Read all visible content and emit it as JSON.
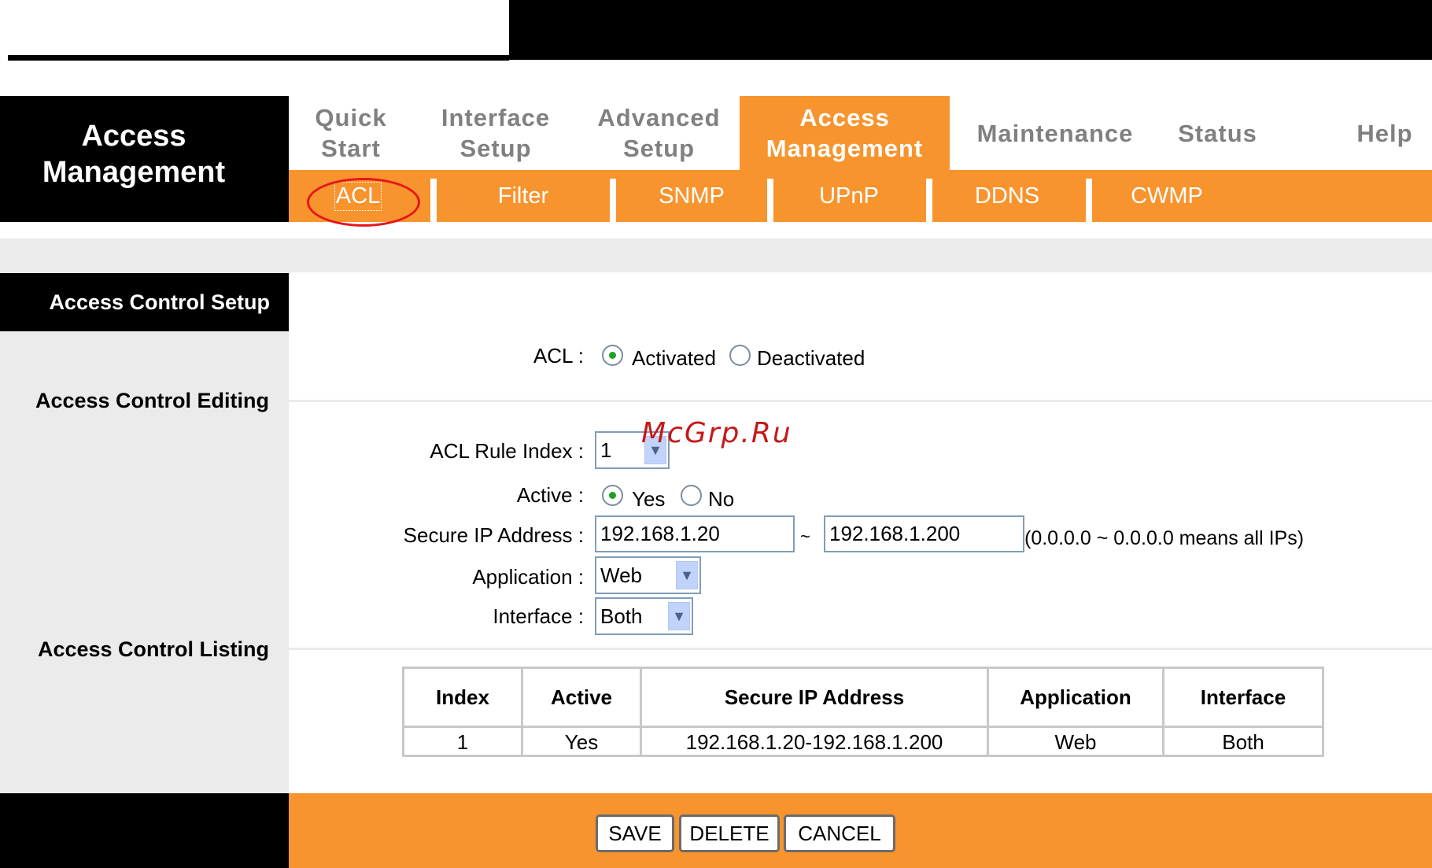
{
  "header": {
    "brand": "Access Management",
    "nav": [
      {
        "label": "Quick Start",
        "active": false
      },
      {
        "label": "Interface Setup",
        "active": false
      },
      {
        "label": "Advanced Setup",
        "active": false
      },
      {
        "label": "Access Management",
        "active": true
      },
      {
        "label": "Maintenance",
        "active": false
      },
      {
        "label": "Status",
        "active": false
      },
      {
        "label": "Help",
        "active": false
      }
    ],
    "subnav": [
      {
        "label": "ACL",
        "selected": true
      },
      {
        "label": "Filter",
        "selected": false
      },
      {
        "label": "SNMP",
        "selected": false
      },
      {
        "label": "UPnP",
        "selected": false
      },
      {
        "label": "DDNS",
        "selected": false
      },
      {
        "label": "CWMP",
        "selected": false
      }
    ]
  },
  "sections": {
    "setup": "Access Control Setup",
    "editing": "Access Control Editing",
    "listing": "Access Control Listing"
  },
  "acl": {
    "label": "ACL :",
    "options": [
      "Activated",
      "Deactivated"
    ],
    "selected": "Activated"
  },
  "editing": {
    "rule_index_label": "ACL Rule Index :",
    "rule_index_value": "1",
    "active_label": "Active :",
    "active_options": [
      "Yes",
      "No"
    ],
    "active_selected": "Yes",
    "ip_label": "Secure IP Address :",
    "ip_start": "192.168.1.20",
    "ip_sep": "~",
    "ip_end": "192.168.1.200",
    "ip_hint": "(0.0.0.0 ~ 0.0.0.0 means all IPs)",
    "application_label": "Application :",
    "application_value": "Web",
    "interface_label": "Interface :",
    "interface_value": "Both"
  },
  "listing": {
    "columns": [
      "Index",
      "Active",
      "Secure IP Address",
      "Application",
      "Interface"
    ],
    "rows": [
      [
        "1",
        "Yes",
        "192.168.1.20-192.168.1.200",
        "Web",
        "Both"
      ]
    ]
  },
  "buttons": {
    "save": "SAVE",
    "delete": "DELETE",
    "cancel": "CANCEL"
  },
  "watermark": "McGrp.Ru",
  "colors": {
    "accent": "#f7942e",
    "highlight_ring": "#e8141b",
    "section_bg": "#000000",
    "panel_gray": "#ebebeb"
  }
}
